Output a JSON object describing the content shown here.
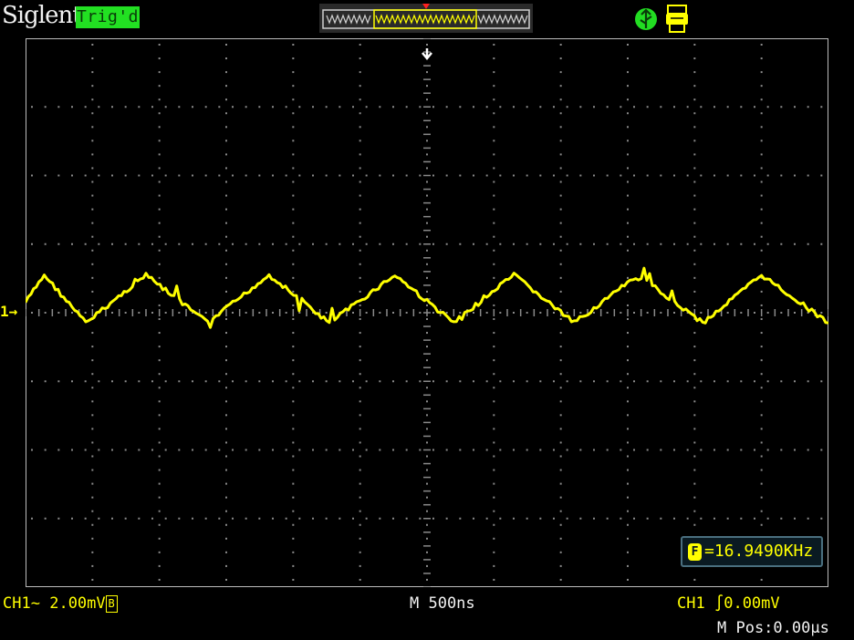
{
  "header": {
    "brand": "Siglent",
    "trigger_status": "Trig'd"
  },
  "status_icons": [
    "usb-icon",
    "printer-icon"
  ],
  "channel": {
    "marker": "1",
    "label": "CH1",
    "coupling_symbol": "~",
    "scale": "2.00mV",
    "bw_limit": "B"
  },
  "timebase": {
    "label": "M 500ns"
  },
  "trigger": {
    "source": "CH1",
    "edge_symbol": "∫",
    "level": "0.00mV"
  },
  "position": {
    "label": "M Pos:0.00μs"
  },
  "measurement": {
    "icon_letter": "F",
    "text": "=16.9490KHz"
  },
  "colors": {
    "trace": "#ffff00",
    "grid": "#8a8a8a",
    "badge": "#22e022",
    "background": "#000000"
  },
  "chart_data": {
    "type": "line",
    "divisions": {
      "horizontal": 12,
      "vertical": 8
    },
    "waveform": "triangle",
    "frequency": "16.9490KHz",
    "time_per_div_ns": 500,
    "volts_per_div_mv": 2.0,
    "x_ns": [
      0,
      140,
      450,
      900,
      1360,
      1820,
      2270,
      2760,
      3200,
      3650,
      4100,
      4580,
      5060,
      5500,
      6000
    ],
    "y_mv": [
      0.3,
      1.1,
      -0.3,
      1.1,
      -0.3,
      1.1,
      -0.3,
      1.1,
      -0.3,
      1.1,
      -0.3,
      1.1,
      -0.3,
      1.1,
      -0.3
    ]
  }
}
